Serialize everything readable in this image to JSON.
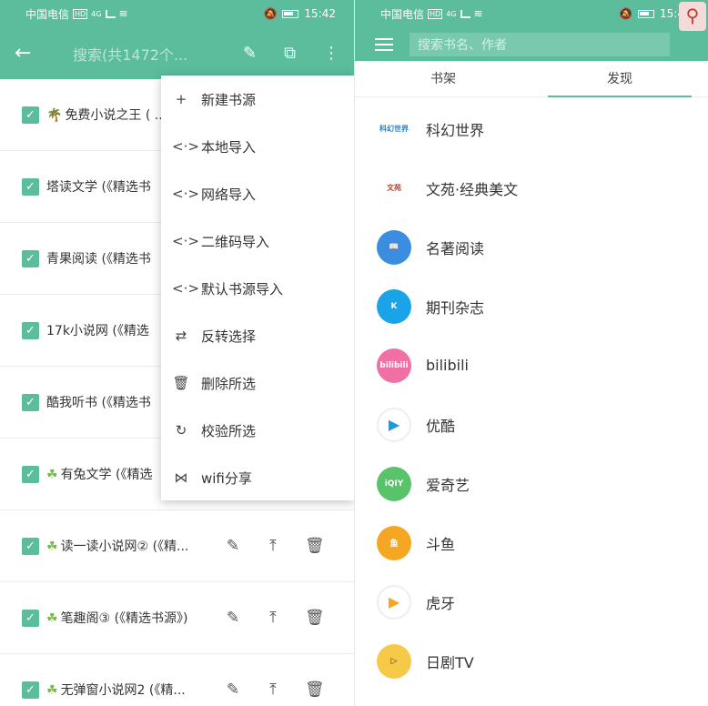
{
  "status_left": {
    "carrier": "中国电信",
    "hd": "HD",
    "net": "4G",
    "time": "15:42"
  },
  "status_right": {
    "carrier": "中国电信",
    "hd": "HD",
    "net": "4G",
    "time": "15:4"
  },
  "left": {
    "search_hint": "搜索(共1472个...",
    "rows": [
      {
        "leaf": "🌴",
        "text": "免费小说之王 ( ..."
      },
      {
        "leaf": "",
        "text": "塔读文学 (《精选书"
      },
      {
        "leaf": "",
        "text": "青果阅读 (《精选书"
      },
      {
        "leaf": "",
        "text": "17k小说网 (《精选"
      },
      {
        "leaf": "",
        "text": "酷我听书 (《精选书"
      },
      {
        "leaf": "☘",
        "text": "有兔文学 (《精选"
      },
      {
        "leaf": "☘",
        "text": "读一读小说网② (《精..."
      },
      {
        "leaf": "☘",
        "text": "笔趣阁③ (《精选书源》)"
      },
      {
        "leaf": "☘",
        "text": "无弹窗小说网2 (《精..."
      }
    ],
    "menu": [
      {
        "icon": "+",
        "label": "新建书源"
      },
      {
        "icon": "<·>",
        "label": "本地导入"
      },
      {
        "icon": "<·>",
        "label": "网络导入"
      },
      {
        "icon": "<·>",
        "label": "二维码导入"
      },
      {
        "icon": "<·>",
        "label": "默认书源导入"
      },
      {
        "icon": "⇄",
        "label": "反转选择"
      },
      {
        "icon": "🗑",
        "label": "删除所选"
      },
      {
        "icon": "↻",
        "label": "校验所选"
      },
      {
        "icon": "⋈",
        "label": "wifi分享"
      }
    ]
  },
  "right": {
    "search_placeholder": "搜索书名、作者",
    "tabs": [
      "书架",
      "发现"
    ],
    "items": [
      {
        "label": "科幻世界",
        "icon_text": "科幻世界",
        "color": "#ffffff",
        "fg": "#2a7fbf",
        "square": true
      },
      {
        "label": "文苑·经典美文",
        "icon_text": "文苑",
        "color": "#ffffff",
        "fg": "#c0392b",
        "square": true
      },
      {
        "label": "名著阅读",
        "icon_text": "📖",
        "color": "#3b8de0",
        "fg": "#ffffff"
      },
      {
        "label": "期刊杂志",
        "icon_text": "K",
        "color": "#1aa3e8",
        "fg": "#ffffff"
      },
      {
        "label": "bilibili",
        "icon_text": "bilibili",
        "color": "#f06fa5",
        "fg": "#ffffff"
      },
      {
        "label": "优酷",
        "icon_text": "▶",
        "color": "#ffffff",
        "fg": "#1e9be0",
        "ring": true
      },
      {
        "label": "爱奇艺",
        "icon_text": "iQIY",
        "color": "#59c36a",
        "fg": "#ffffff"
      },
      {
        "label": "斗鱼",
        "icon_text": "鱼",
        "color": "#f5a623",
        "fg": "#ffffff"
      },
      {
        "label": "虎牙",
        "icon_text": "▶",
        "color": "#ffffff",
        "fg": "#f5a623",
        "ring": true
      },
      {
        "label": "日剧TV",
        "icon_text": "▷",
        "color": "#f7c948",
        "fg": "#333333"
      }
    ]
  }
}
